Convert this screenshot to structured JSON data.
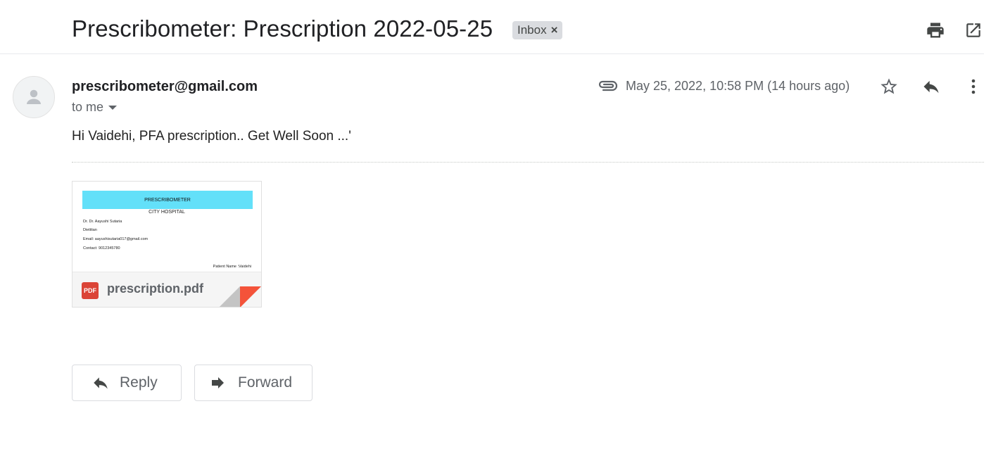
{
  "header": {
    "subject": "Prescribometer: Prescription 2022-05-25",
    "label": "Inbox",
    "label_remove": "×"
  },
  "message": {
    "sender": "prescribometer@gmail.com",
    "recipient": "to me",
    "date": "May 25, 2022, 10:58 PM (14 hours ago)",
    "body": "Hi Vaidehi, PFA prescription.. Get Well Soon ...'"
  },
  "attachment": {
    "filename": "prescription.pdf",
    "type_badge": "PDF",
    "preview": {
      "banner": "PRESCRIBOMETER",
      "hospital": "CITY HOSPITAL",
      "doctor": "Dr. Dr. Aayushi Sutaria",
      "role": "Dietitian",
      "email": "Email: aayushisutaria017@gmail.com",
      "contact": "Contact: 9012345780",
      "patient": "Patient Name :Vaidehi"
    }
  },
  "actions": {
    "reply": "Reply",
    "forward": "Forward"
  },
  "icons": {
    "print": "print-icon",
    "open_new_window": "open-in-new-window-icon",
    "attachment": "paperclip-icon",
    "star": "star-icon",
    "reply": "reply-icon",
    "more": "more-vertical-icon",
    "avatar": "default-avatar-icon",
    "dropdown": "caret-down-icon",
    "forward": "forward-arrow-icon"
  },
  "colors": {
    "pdf_red": "#db4437",
    "banner_cyan": "#63e0f9",
    "label_bg": "#dadce0"
  }
}
